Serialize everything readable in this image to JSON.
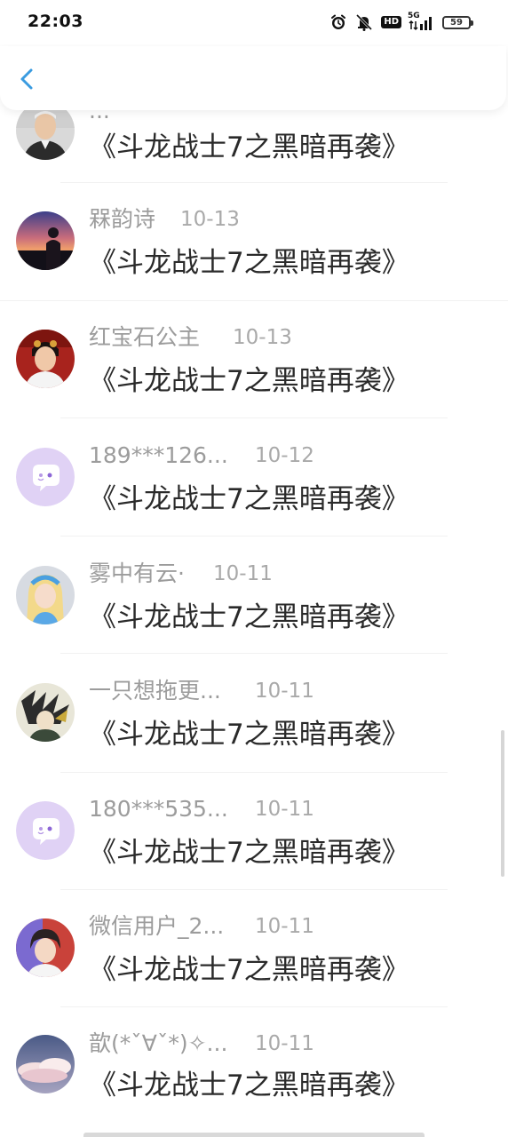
{
  "status_bar": {
    "time": "22:03",
    "network": "5G",
    "hd": "HD",
    "battery": "59",
    "icons": [
      "alarm-icon",
      "mute-icon",
      "hd-icon",
      "signal-icon",
      "battery-icon"
    ]
  },
  "header": {
    "back_icon": "chevron-left-icon",
    "accent": "#3a9be0"
  },
  "comments": [
    {
      "name": "...",
      "date": "",
      "text": "《斗龙战士7之黑暗再袭》",
      "avatar": "elderly-man-photo"
    },
    {
      "name": "槑韵诗",
      "date": "10-13",
      "text": "《斗龙战士7之黑暗再袭》",
      "avatar": "sunset-silhouette-photo"
    },
    {
      "name": "红宝石公主",
      "date": "10-13",
      "text": "《斗龙战士7之黑暗再袭》",
      "avatar": "woman-portrait-photo"
    },
    {
      "name": "189***126...",
      "date": "10-12",
      "text": "《斗龙战士7之黑暗再袭》",
      "avatar": "default-chat-avatar"
    },
    {
      "name": "雾中有云·",
      "date": "10-11",
      "text": "《斗龙战士7之黑暗再袭》",
      "avatar": "blonde-anime-girl"
    },
    {
      "name": "一只想拖更...",
      "date": "10-11",
      "text": "《斗龙战士7之黑暗再袭》",
      "avatar": "anime-character-art"
    },
    {
      "name": "180***535...",
      "date": "10-11",
      "text": "《斗龙战士7之黑暗再袭》",
      "avatar": "default-chat-avatar"
    },
    {
      "name": "微信用户_2...",
      "date": "10-11",
      "text": "《斗龙战士7之黑暗再袭》",
      "avatar": "young-man-photo"
    },
    {
      "name": "歆(*ˇ∀ˇ*)✧...",
      "date": "10-11",
      "text": "《斗龙战士7之黑暗再袭》",
      "avatar": "cloud-sky-photo"
    }
  ]
}
